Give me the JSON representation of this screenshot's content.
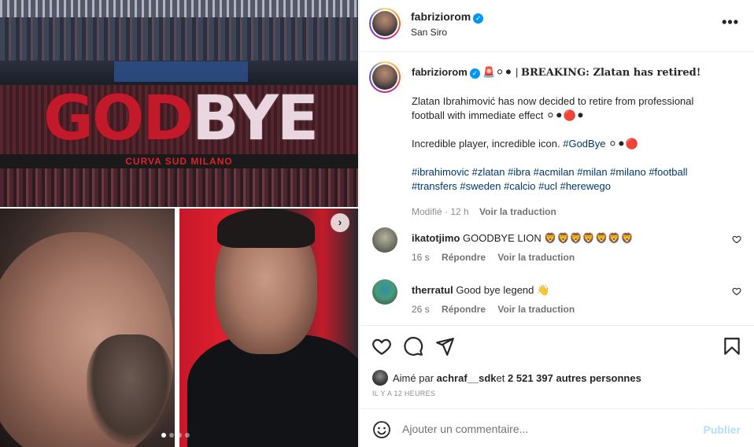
{
  "media": {
    "banner_god": "GOD",
    "banner_bye": "BYE",
    "stand_text": "CURVA SUD MILANO",
    "carousel_dots": 4,
    "active_dot": 0
  },
  "header": {
    "username": "fabriziorom",
    "location": "San Siro",
    "more_label": "•••"
  },
  "caption": {
    "username": "fabriziorom",
    "emoji_prefix": "🚨⚪⚫",
    "headline": "BREAKING: Zlatan has retired!",
    "body_1": "Zlatan Ibrahimović has now decided to retire from professional football with immediate effect ⚪⚫🔴⚫",
    "body_2_text": "Incredible player, incredible icon. ",
    "body_2_tag": "#GodBye",
    "body_2_suffix": " ⚪⚫🔴",
    "hashtags": "#ibrahimovic #zlatan #ibra #acmilan #milan #milano #football #transfers #sweden #calcio #ucl #herewego",
    "edited": "Modifié · 12 h",
    "translate": "Voir la traduction"
  },
  "comments": [
    {
      "username": "ikatotjimo",
      "text": "GOODBYE LION 🦁🦁🦁🦁🦁🦁🦁",
      "time": "16 s",
      "reply": "Répondre",
      "translate": "Voir la traduction"
    },
    {
      "username": "therratul",
      "text": "Good bye legend 👋",
      "time": "26 s",
      "reply": "Répondre",
      "translate": "Voir la traduction"
    }
  ],
  "likes": {
    "prefix": "Aimé par ",
    "user": "achraf__sdk",
    "middle": " et ",
    "count": "2 521 397 autres personnes"
  },
  "time_ago": "IL Y A 12 HEURES",
  "add_comment": {
    "placeholder": "Ajouter un commentaire...",
    "publish": "Publier"
  },
  "icons": [
    "heart-icon",
    "comment-icon",
    "share-icon",
    "bookmark-icon",
    "emoji-icon",
    "chevron-right-icon"
  ]
}
